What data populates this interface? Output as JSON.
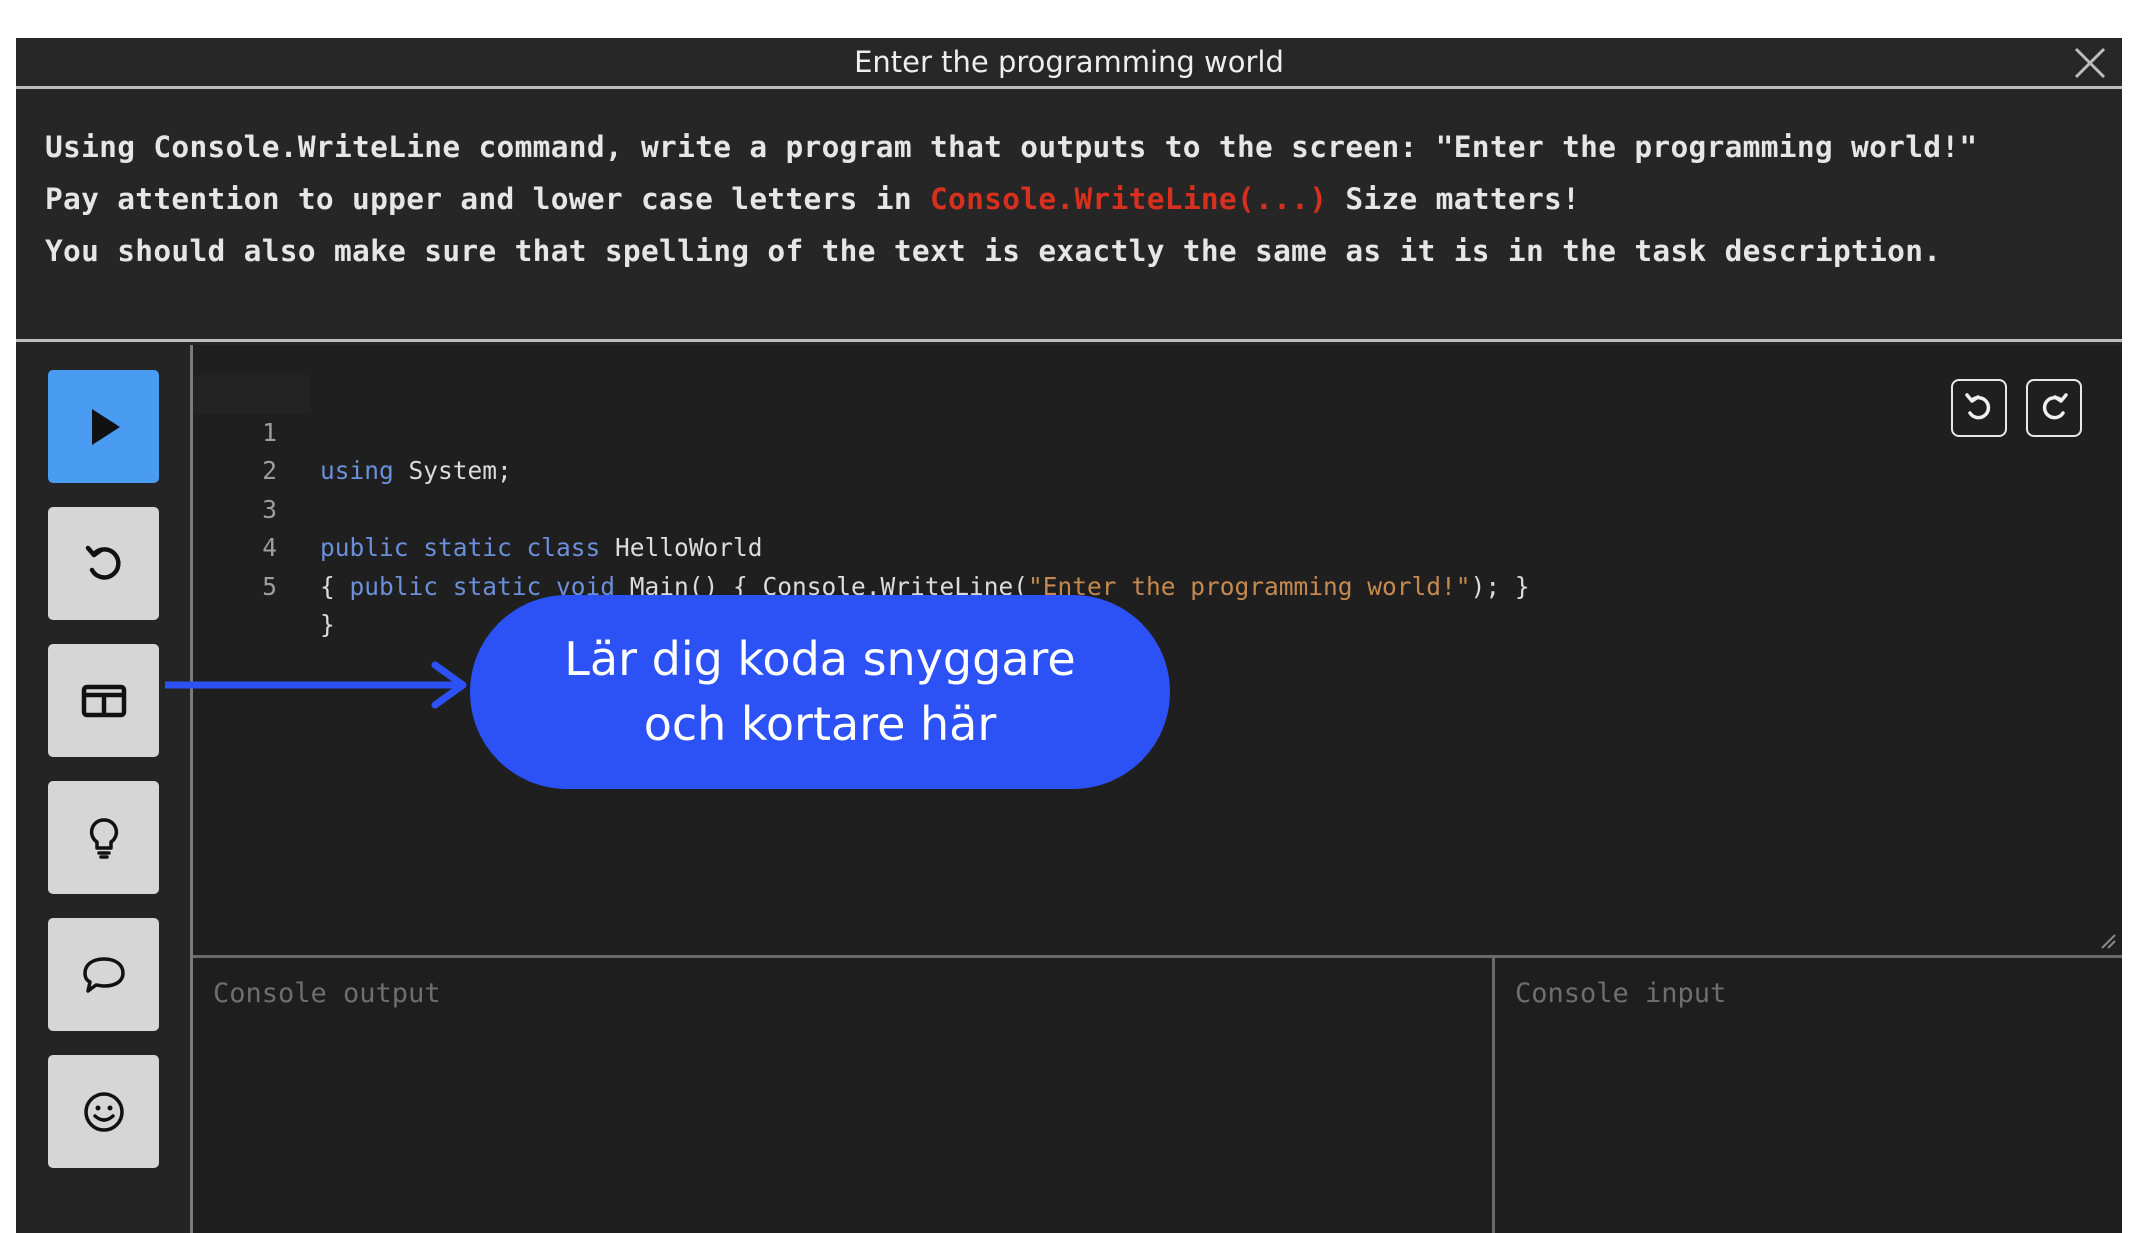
{
  "window": {
    "title": "Enter the programming world"
  },
  "task": {
    "line1": "Using Console.WriteLine command, write a program that outputs to the screen: \"Enter the programming world!\"",
    "line2_prefix": "Pay attention to upper and lower case letters in ",
    "line2_highlight": "Console.WriteLine(...)",
    "line2_suffix": " Size matters!",
    "line3": "You should also make sure that spelling of the text is exactly the same as it is in the task description.",
    "highlight_color": "#d7301f"
  },
  "sidebar": {
    "buttons": [
      {
        "name": "run",
        "icon": "play-icon"
      },
      {
        "name": "reset",
        "icon": "reset-icon"
      },
      {
        "name": "layout",
        "icon": "layout-icon"
      },
      {
        "name": "hint",
        "icon": "lightbulb-icon"
      },
      {
        "name": "comment",
        "icon": "chat-icon"
      },
      {
        "name": "feedback",
        "icon": "smiley-icon"
      }
    ],
    "run_color": "#4a9cf3"
  },
  "editor": {
    "lines": [
      {
        "num": "1",
        "kw": "using",
        "rest": " System;"
      },
      {
        "num": "2"
      },
      {
        "num": "3",
        "kw": "public static class",
        "rest": " HelloWorld"
      },
      {
        "num": "4",
        "pre": "{ ",
        "kw": "public static void",
        "mid": " Main() { Console.WriteLine(",
        "str": "\"Enter the programming world!\"",
        "post": "); }"
      },
      {
        "num": "5",
        "rest": "}"
      }
    ],
    "undo_icon": "undo-icon",
    "redo_icon": "redo-icon"
  },
  "console": {
    "output_placeholder": "Console output",
    "input_placeholder": "Console input"
  },
  "callout": {
    "line1": "Lär dig koda snyggare",
    "line2": "och kortare här",
    "color": "#2c52f5"
  }
}
